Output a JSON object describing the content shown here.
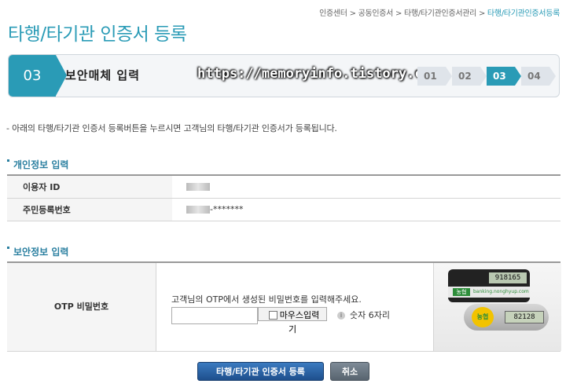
{
  "breadcrumb": {
    "items": [
      "인증센터",
      "공동인증서",
      "타행/타기관인증서관리"
    ],
    "separator": ">",
    "current": "타행/타기관인증서등록"
  },
  "page_title": "타행/타기관 인증서 등록",
  "step_bar": {
    "current_num": "03",
    "current_label": "보안매체 입력",
    "watermark": "https://memoryinfo.tistory.com",
    "steps": [
      "01",
      "02",
      "03",
      "04"
    ],
    "active_index": 2
  },
  "notice": "- 아래의 타행/타기관 인증서 등록버튼을 누르시면 고객님의 타행/타기관 인증서가 등록됩니다.",
  "personal_section": {
    "title": "개인정보 입력",
    "rows": [
      {
        "label": "이용자 ID",
        "value_suffix": ""
      },
      {
        "label": "주민등록번호",
        "value_suffix": "-*******"
      }
    ]
  },
  "security_section": {
    "title": "보안정보 입력",
    "otp_label": "OTP 비밀번호",
    "instruction": "고객님의 OTP에서 생성된 비밀번호를 입력해주세요.",
    "input_value": "",
    "mouse_input_label": "마우스입력기",
    "hint": "숫자 6자리",
    "image": {
      "card_display": "918165",
      "fob_display": "82128",
      "card_logo": "농협",
      "card_url": "banking.nonghyup.com",
      "fob_logo": "농협"
    }
  },
  "buttons": {
    "register": "타행/타기관 인증서 등록",
    "cancel": "취소"
  },
  "colors": {
    "accent": "#2a9bb6",
    "button_primary": "#1e4f8d",
    "button_secondary": "#58646f"
  }
}
